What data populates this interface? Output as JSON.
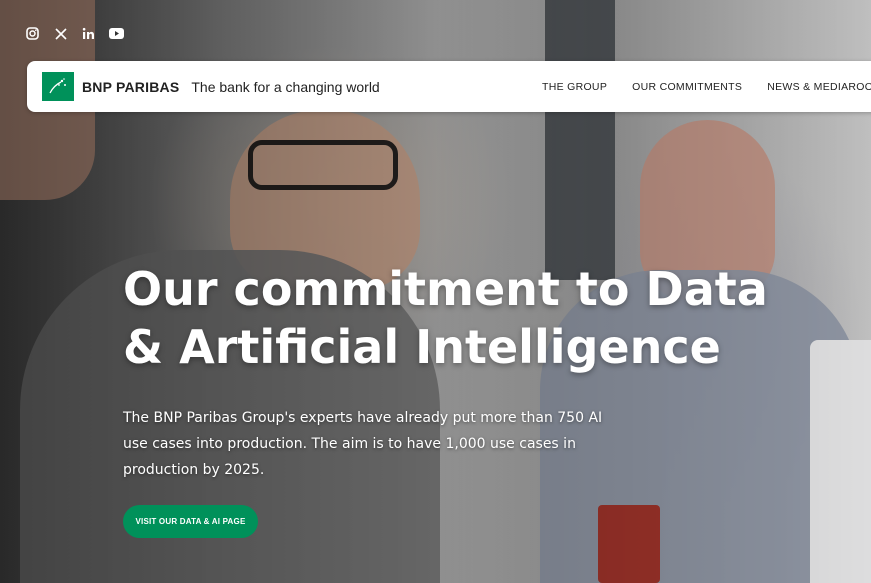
{
  "social": {
    "icons": [
      "instagram-icon",
      "x-icon",
      "linkedin-icon",
      "youtube-icon"
    ]
  },
  "header": {
    "brand": "BNP PARIBAS",
    "tagline": "The bank for a changing world",
    "nav": [
      "THE GROUP",
      "OUR COMMITMENTS",
      "NEWS & MEDIAROOM"
    ]
  },
  "hero": {
    "headline_line1": "Our commitment to Data",
    "headline_line2": "& Artificial Intelligence",
    "subtext": "The BNP Paribas Group's experts have already put more than 750 AI use cases into production. The aim is to have 1,000 use cases in production by 2025.",
    "cta_label": "VISIT OUR DATA & AI PAGE"
  },
  "colors": {
    "brand_green": "#00915a",
    "header_bg": "#ffffff",
    "text_dark": "#222222"
  }
}
